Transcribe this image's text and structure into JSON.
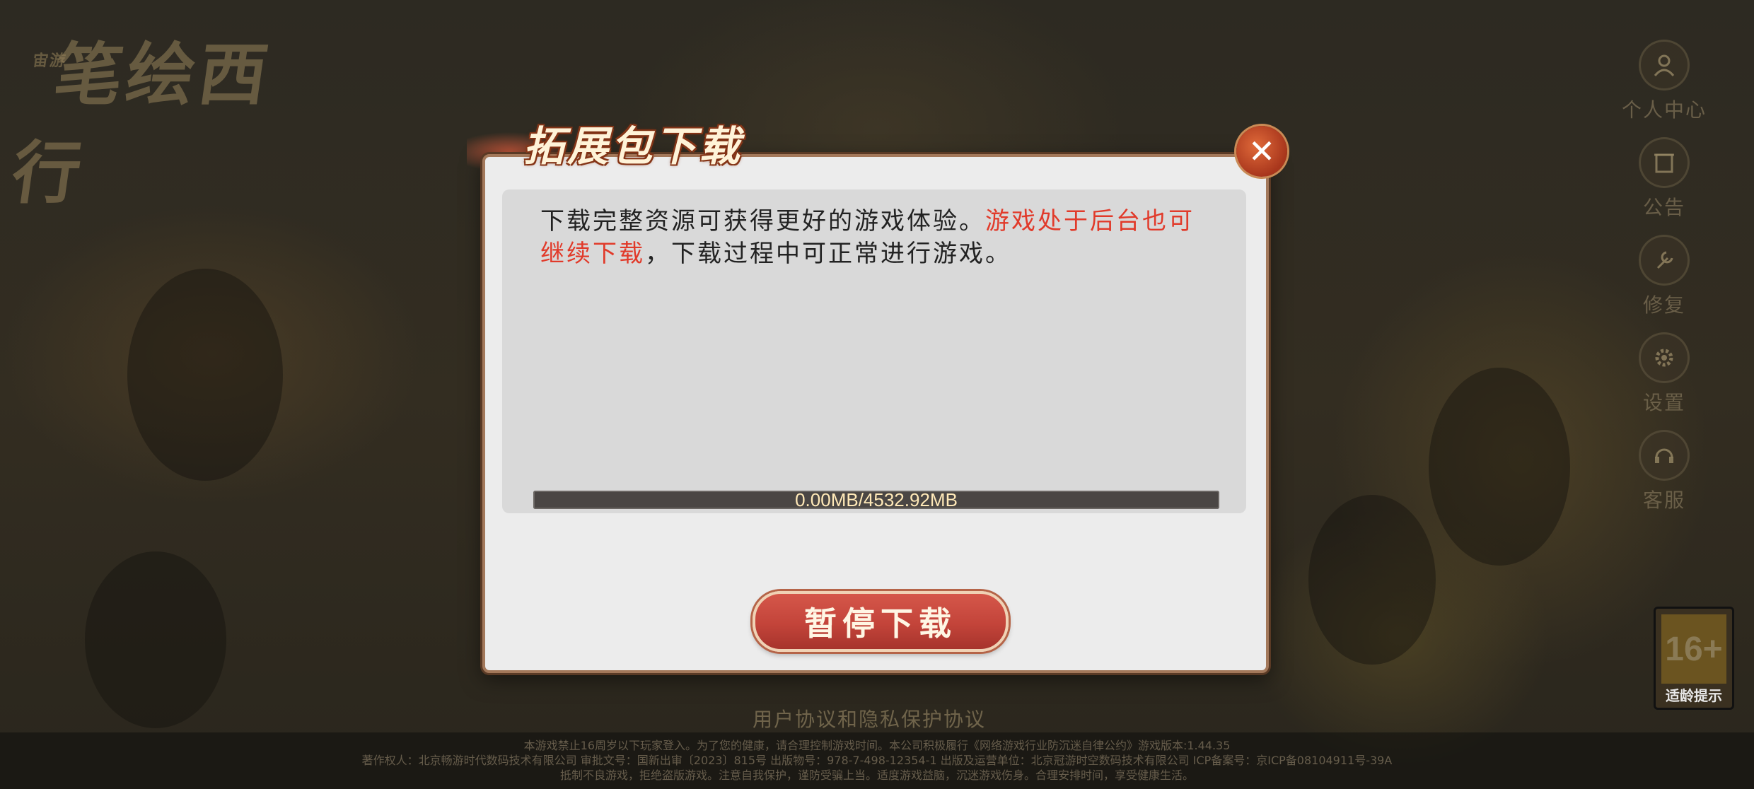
{
  "background": {
    "logo_text": "笔绘西行",
    "logo_small": "宙游"
  },
  "side_menu": {
    "items": [
      {
        "label": "个人中心",
        "icon": "person-icon"
      },
      {
        "label": "公告",
        "icon": "notice-icon"
      },
      {
        "label": "修复",
        "icon": "wrench-icon"
      },
      {
        "label": "设置",
        "icon": "gear-icon"
      },
      {
        "label": "客服",
        "icon": "headset-icon"
      }
    ]
  },
  "age_badge": {
    "rating": "16+",
    "label": "适龄提示"
  },
  "agreement_link": "用户协议和隐私保护协议",
  "footer": {
    "line1": "本游戏禁止16周岁以下玩家登入。为了您的健康，请合理控制游戏时间。本公司积极履行《网络游戏行业防沉迷自律公约》游戏版本:1.44.35",
    "line2": "著作权人：北京畅游时代数码技术有限公司 审批文号：国新出审〔2023〕815号 出版物号：978-7-498-12354-1 出版及运营单位：北京冠游时空数码技术有限公司 ICP备案号：京ICP备08104911号-39A",
    "line3": "抵制不良游戏，拒绝盗版游戏。注意自我保护，谨防受骗上当。适度游戏益脑，沉迷游戏伤身。合理安排时间，享受健康生活。"
  },
  "dialog": {
    "title": "拓展包下载",
    "close_glyph": "✕",
    "desc_normal_1": "下载完整资源可获得更好的游戏体验。",
    "desc_highlight": "游戏处于后台也可继续下载",
    "desc_normal_2": "，下载过程中可正常进行游戏。",
    "progress": {
      "text": "0.00MB/4532.92MB",
      "fraction": 0.0
    },
    "pause_button_label": "暂停下载"
  }
}
